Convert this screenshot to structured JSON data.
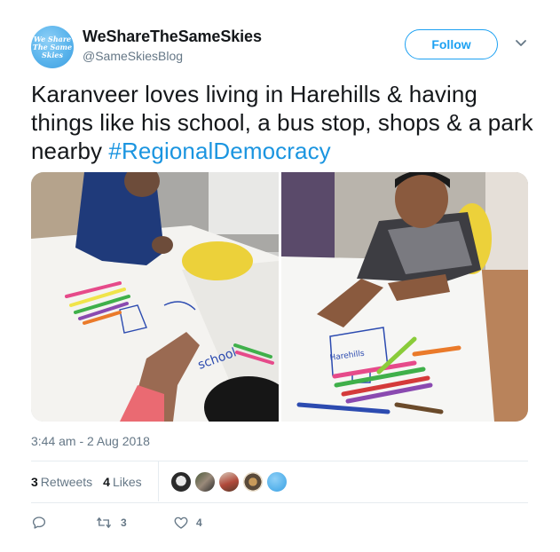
{
  "header": {
    "avatar_lines": [
      "We Share",
      "The Same",
      "Skies"
    ],
    "display_name": "WeShareTheSameSkies",
    "handle": "@SameSkiesBlog",
    "follow_label": "Follow"
  },
  "tweet": {
    "text": "Karanveer loves living in Harehills & having things like his school, a bus stop, shops & a park nearby ",
    "hashtag": "#RegionalDemocracy",
    "timestamp": "3:44 am - 2 Aug 2018"
  },
  "media": {
    "photos": [
      {
        "name": "photo-left",
        "marker": "school"
      },
      {
        "name": "photo-right",
        "marker": "Harehills"
      }
    ]
  },
  "stats": {
    "retweets_count": "3",
    "retweets_label": "Retweets",
    "likes_count": "4",
    "likes_label": "Likes",
    "liker_avatars": 5
  },
  "actions": {
    "reply_count": "",
    "retweet_count": "3",
    "like_count": "4"
  },
  "colors": {
    "accent": "#1da1f2",
    "hashtag": "#1b95e0",
    "secondary_text": "#657786",
    "divider": "#e6ecf0"
  },
  "icons": [
    "reply-icon",
    "retweet-icon",
    "heart-icon",
    "chevron-down-icon"
  ]
}
